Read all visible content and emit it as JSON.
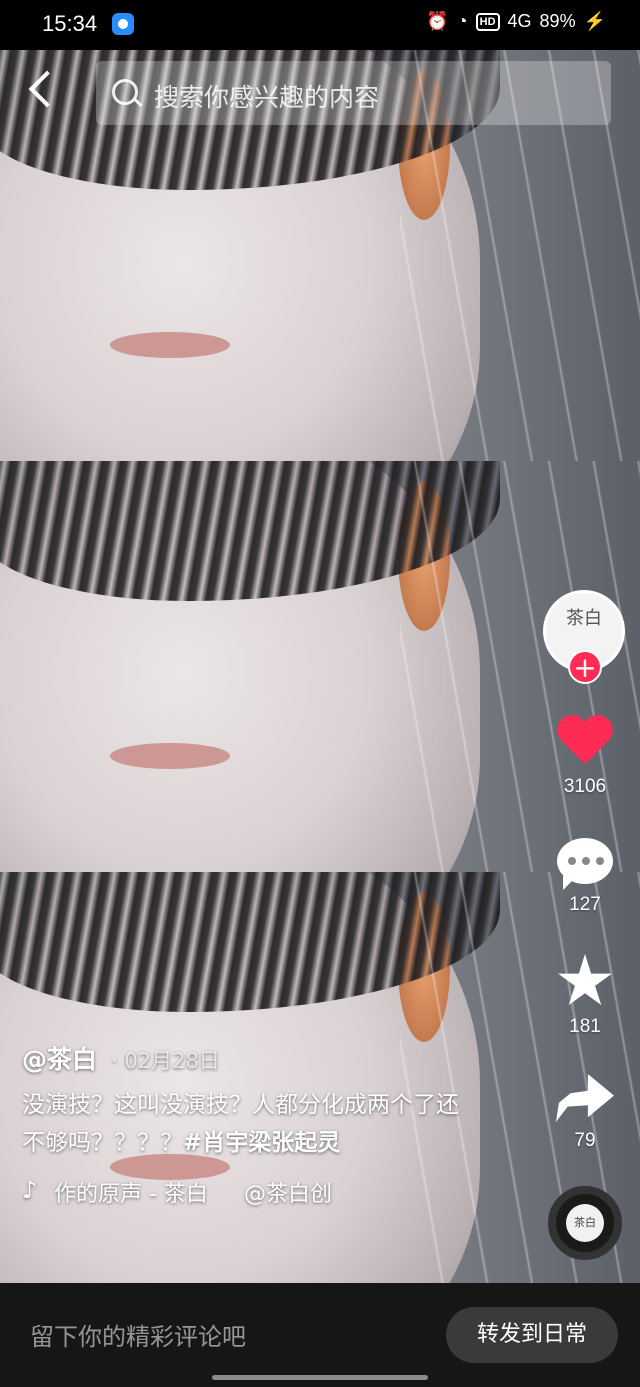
{
  "status_bar": {
    "time": "15:34",
    "network_badge": "HD",
    "signal": "4G",
    "battery": "89%"
  },
  "search": {
    "placeholder": "搜索你感兴趣的内容"
  },
  "sidebar": {
    "avatar_text": "茶白",
    "follow_symbol": "+",
    "likes": "3106",
    "comments": "127",
    "favorites": "181",
    "shares": "79",
    "disc_text": "茶白"
  },
  "post": {
    "author": "@茶白",
    "date": "· 02月28日",
    "description": "没演技？这叫没演技？人都分化成两个了还不够吗？？？？",
    "hashtag": "#肖宇梁张起灵",
    "music": "作的原声 - 茶白",
    "music_author": "@茶白创"
  },
  "bottom": {
    "comment_placeholder": "留下你的精彩评论吧",
    "repost_label": "转发到日常"
  },
  "colors": {
    "like_red": "#fe2c55",
    "bottom_bar": "#161616"
  },
  "icons": [
    "back-icon",
    "search-icon",
    "heart-icon",
    "comment-icon",
    "star-icon",
    "share-icon",
    "music-note-icon",
    "music-disc-icon"
  ]
}
